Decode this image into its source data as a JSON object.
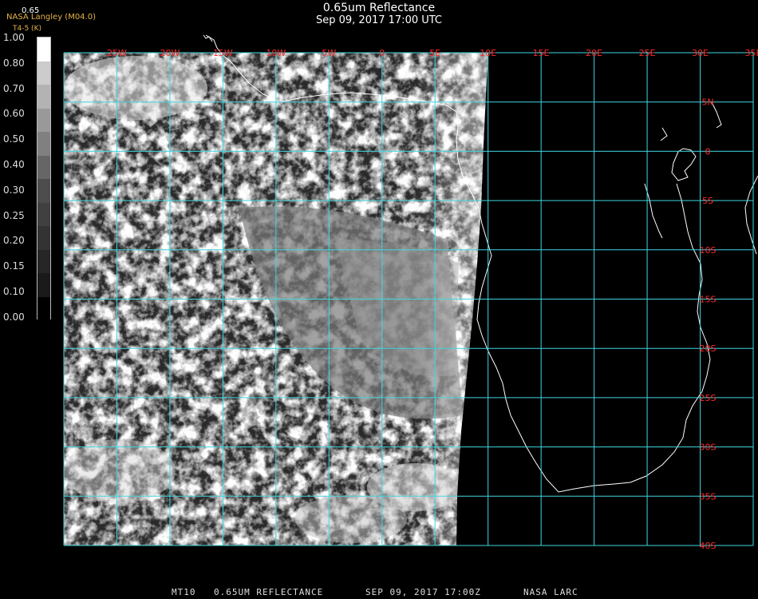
{
  "header": {
    "title": "0.65um Reflectance",
    "subtitle": "Sep 09, 2017 17:00 UTC"
  },
  "logo": {
    "line1": "NASA Langley (M04.0)",
    "line2": "T4-5 (K)",
    "color": "#e5b34a"
  },
  "colorbar": {
    "top_label": "0.65",
    "ticks": [
      "1.00",
      "0.80",
      "0.70",
      "0.60",
      "0.50",
      "0.40",
      "0.30",
      "0.25",
      "0.20",
      "0.15",
      "0.10",
      "0.00"
    ]
  },
  "map": {
    "grid_color": "#3fd6e0",
    "label_color": "#ff2a2a",
    "lon_labels": [
      "25W",
      "20W",
      "15W",
      "10W",
      "5W",
      "0",
      "5E",
      "10E",
      "15E",
      "20E",
      "25E",
      "30E",
      "35E"
    ],
    "lat_labels": [
      "5N",
      "0",
      "5S",
      "10S",
      "15S",
      "20S",
      "25S",
      "30S",
      "35S",
      "40S"
    ],
    "extent": {
      "lon_min": -30,
      "lon_max": 35,
      "lat_max": 10,
      "lat_min": -40
    }
  },
  "footer": {
    "product": "MT10",
    "channel": "0.65UM REFLECTANCE",
    "datetime": "SEP 09, 2017 17:00Z",
    "source": "NASA LARC"
  }
}
